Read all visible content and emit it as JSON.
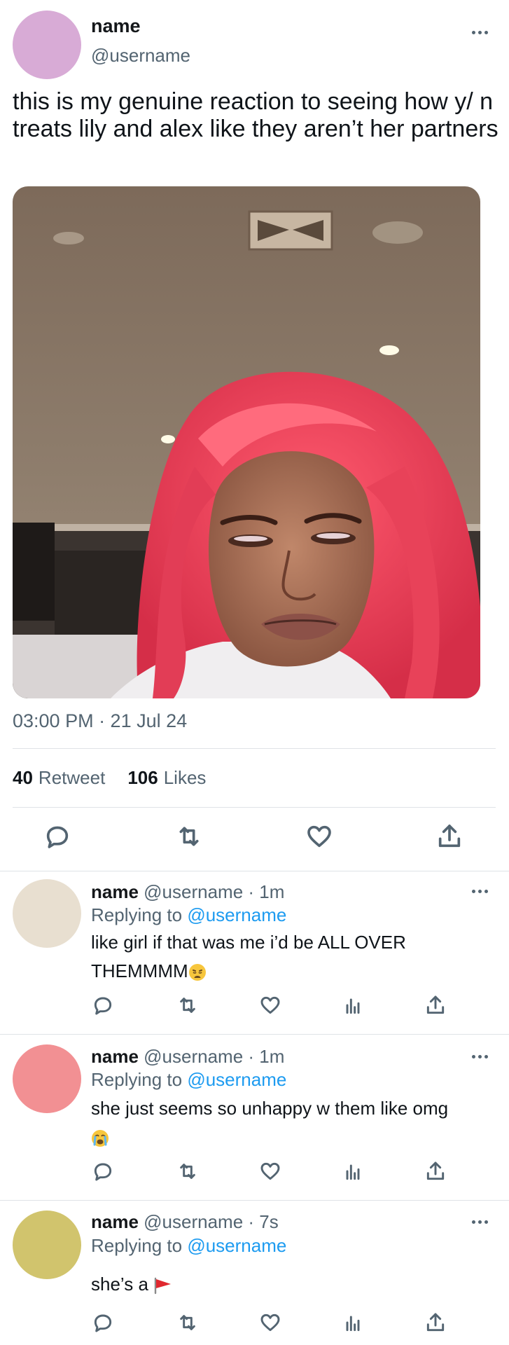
{
  "main_tweet": {
    "name": "name",
    "handle": "@username",
    "avatar_color": "#d8abd6",
    "text": "this is my genuine reaction to seeing how y/ n treats lily and alex like they aren’t her partners",
    "timestamp": "03:00 PM · 21 Jul 24",
    "retweets": "40",
    "retweets_label": "Retweet",
    "likes": "106",
    "likes_label": "Likes"
  },
  "replies": [
    {
      "name": "name",
      "handle": "@username",
      "time": "· 1m",
      "replying_prefix": "Replying to",
      "replying_to": "@username",
      "text": "like girl if that was me i’d be ALL OVER THEMMMM",
      "emoji": "weary-face",
      "avatar_color": "#e8dfd0"
    },
    {
      "name": "name",
      "handle": "@username",
      "time": "· 1m",
      "replying_prefix": "Replying to",
      "replying_to": "@username",
      "text": "she just seems so unhappy w them like omg",
      "emoji": "loudly-crying-face",
      "avatar_color": "#f29093"
    },
    {
      "name": "name",
      "handle": "@username",
      "time": "· 7s",
      "replying_prefix": "Replying to",
      "replying_to": "@username",
      "text": "she’s a",
      "emoji": "red-flag",
      "avatar_color": "#d1c46d"
    }
  ],
  "icons": {
    "reply": "speech-bubble-icon",
    "retweet": "retweet-icon",
    "like": "heart-icon",
    "views": "bar-chart-icon",
    "share": "share-icon",
    "more": "more-dots-icon"
  },
  "colors": {
    "link": "#1d9bf0",
    "secondary_text": "#536471",
    "divider": "#dfe3e7"
  }
}
